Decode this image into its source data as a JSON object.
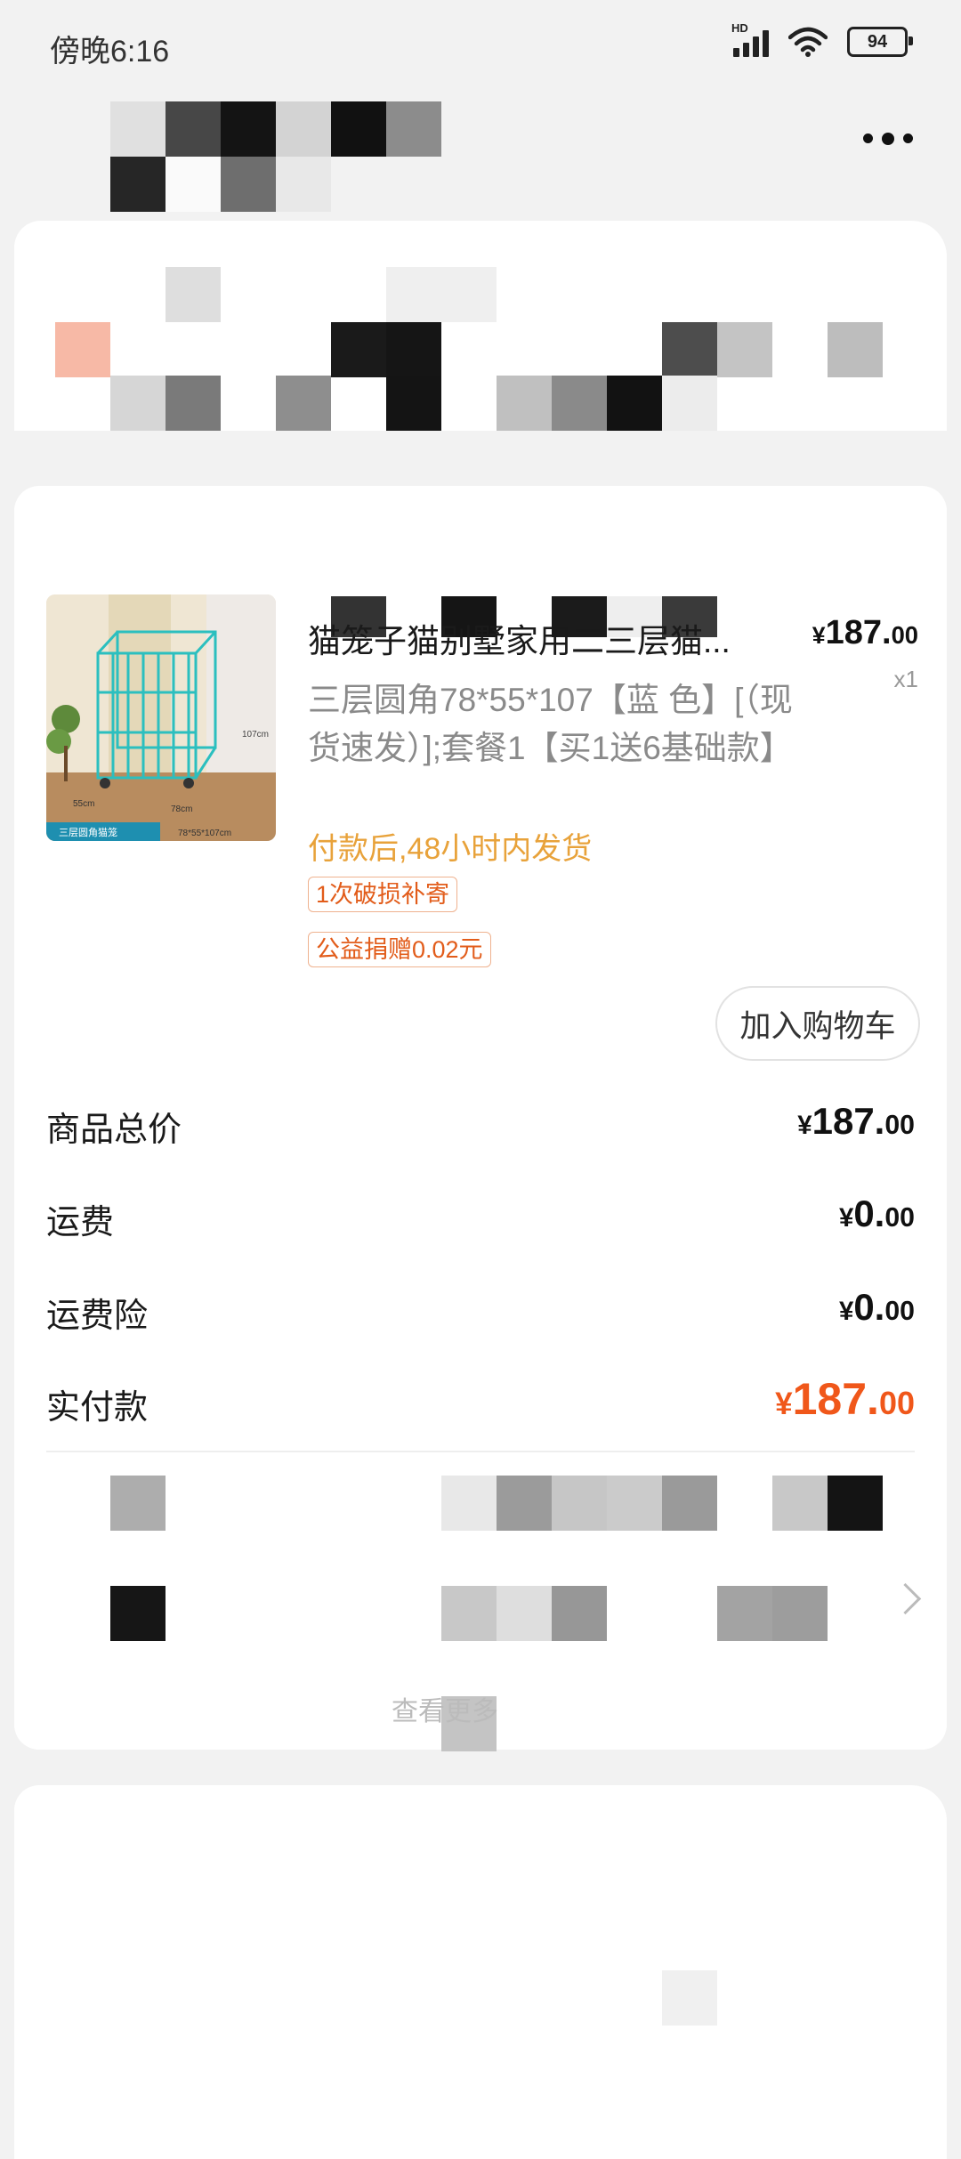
{
  "status_bar": {
    "time": "傍晚6:16",
    "battery": "94"
  },
  "product": {
    "title": "猫笼子猫别墅家用二三层猫...",
    "price_int": "187.",
    "price_dec": "00",
    "currency": "¥",
    "qty": "x1",
    "spec": "三层圆角78*55*107【蓝 色】[（现货速发）];套餐1【买1送6基础款】",
    "shipping_note": "付款后,48小时内发货",
    "tags": [
      "1次破损补寄",
      "公益捐赠0.02元"
    ],
    "thumb_labels": {
      "height": "107cm",
      "depth": "55cm",
      "width": "78cm",
      "banner": "三层圆角猫笼",
      "dims": "78*55*107cm"
    }
  },
  "add_to_cart_label": "加入购物车",
  "summary": [
    {
      "label": "商品总价",
      "int": "187.",
      "dec": "00"
    },
    {
      "label": "运费",
      "int": "0.",
      "dec": "00"
    },
    {
      "label": "运费险",
      "int": "0.",
      "dec": "00"
    },
    {
      "label": "实付款",
      "int": "187.",
      "dec": "00"
    }
  ],
  "view_more": "查看更多",
  "colors": {
    "accent": "#f0571a",
    "shipping": "#e8a23a",
    "tag_text": "#e25c1a"
  }
}
